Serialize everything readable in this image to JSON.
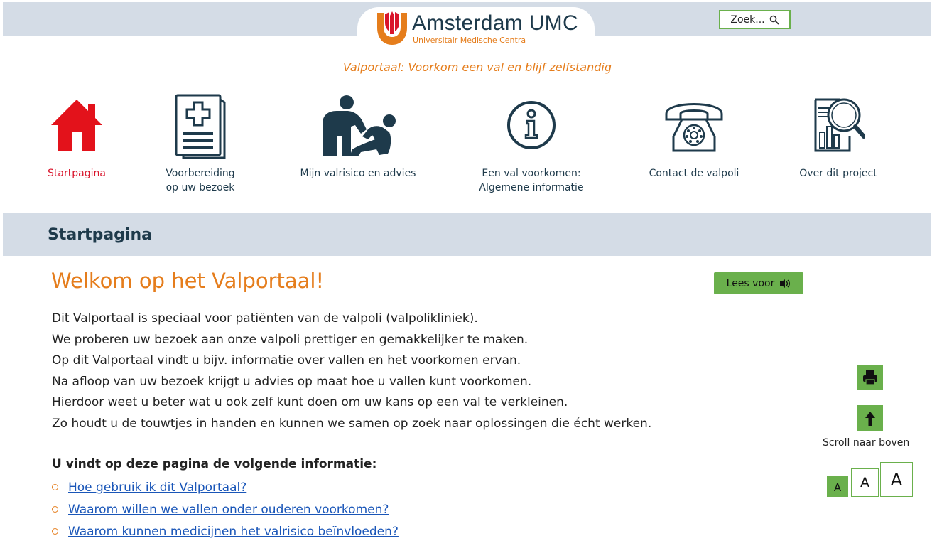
{
  "header": {
    "logo_title": "Amsterdam UMC",
    "logo_subtitle": "Universitair Medische Centra",
    "search_label": "Zoek...",
    "tagline": "Valportaal: Voorkom een val en blijf zelfstandig"
  },
  "nav": {
    "items": [
      {
        "label": "Startpagina",
        "icon": "home-icon",
        "active": true
      },
      {
        "label": "Voorbereiding\nop uw bezoek",
        "icon": "medical-document-icon",
        "active": false
      },
      {
        "label": "Mijn valrisico en advies",
        "icon": "fall-assist-icon",
        "active": false
      },
      {
        "label": "Een val voorkomen:\nAlgemene informatie",
        "icon": "info-icon",
        "active": false
      },
      {
        "label": "Contact de valpoli",
        "icon": "telephone-icon",
        "active": false
      },
      {
        "label": "Over dit project",
        "icon": "report-search-icon",
        "active": false
      }
    ]
  },
  "section": {
    "title": "Startpagina"
  },
  "main": {
    "heading": "Welkom op het Valportaal!",
    "listen_label": "Lees voor",
    "paragraphs": [
      "Dit Valportaal is speciaal voor patiënten van de valpoli (valpolikliniek).",
      "We proberen uw bezoek aan onze valpoli prettiger en gemakkelijker te maken.",
      "Op dit Valportaal vindt u bijv. informatie over vallen en het voorkomen ervan.",
      "Na afloop van uw bezoek krijgt u advies op maat hoe u vallen kunt voorkomen.",
      "Hierdoor weet u beter wat u ook zelf kunt doen om uw kans op een val te verkleinen.",
      "Zo houdt u de touwtjes in handen en kunnen we samen op zoek naar oplossingen die écht werken."
    ],
    "info_heading": "U vindt op deze pagina de volgende informatie:",
    "links": [
      "Hoe gebruik ik dit Valportaal?",
      "Waarom willen we vallen onder ouderen voorkomen?",
      "Waarom kunnen medicijnen het valrisico beïnvloeden?"
    ]
  },
  "tools": {
    "print_icon": "printer-icon",
    "scroll_icon": "arrow-up-icon",
    "scroll_label": "Scroll naar boven",
    "font_sizes": [
      "A",
      "A",
      "A"
    ]
  },
  "colors": {
    "brand_orange": "#e57d1c",
    "navy": "#1e3a4b",
    "accent_green": "#6ab04c",
    "active_red": "#d9142b",
    "bar_gray": "#d4dce6",
    "link_blue": "#1a56b8"
  }
}
